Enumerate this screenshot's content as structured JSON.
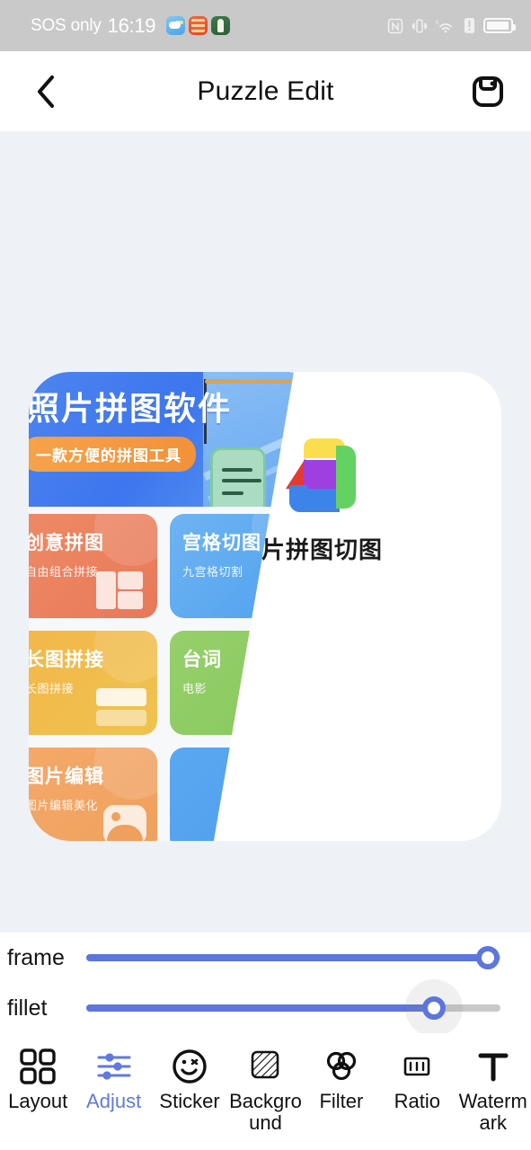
{
  "statusbar": {
    "carrier": "SOS only",
    "time": "16:19",
    "app_icons": [
      "weather-app-icon",
      "orange-app-icon",
      "green-app-icon"
    ],
    "right_icons": [
      "nfc-icon",
      "vibrate-icon",
      "wifi-6-icon",
      "sim-alert-icon",
      "battery-icon"
    ]
  },
  "titlebar": {
    "back_icon": "chevron-left-icon",
    "title": "Puzzle Edit",
    "save_icon": "save-icon"
  },
  "canvas": {
    "background_color": "#eef1f6",
    "left_photo": {
      "hero_title": "照片拼图软件",
      "hero_pill": "一款方便的拼图工具",
      "cards": [
        {
          "title": "创意拼图",
          "subtitle": "自由组合拼接",
          "color": "#ef8a65"
        },
        {
          "title": "宫格切图",
          "subtitle": "九宫格切割",
          "color": "#6fb4f2"
        },
        {
          "title": "长图拼接",
          "subtitle": "长图拼接",
          "color": "#f3b64a"
        },
        {
          "title": "台词",
          "subtitle": "电影",
          "color": "#97cf6b"
        },
        {
          "title": "图片编辑",
          "subtitle": "图片编辑美化",
          "color": "#f4a96a"
        },
        {
          "title": "",
          "subtitle": "",
          "color": "#5aa8f0"
        }
      ]
    },
    "right_photo": {
      "logo_icon": "puzzle-app-logo-icon",
      "label": "照片拼图切图",
      "background_color": "#ffffff"
    }
  },
  "sliders": [
    {
      "label": "frame",
      "value": 97
    },
    {
      "label": "fillet",
      "value": 84
    }
  ],
  "slider_colors": {
    "fill": "#5d76dc",
    "track": "#c9c9c9"
  },
  "tabs": [
    {
      "label": "Layout",
      "icon": "grid-layout-icon",
      "active": false
    },
    {
      "label": "Adjust",
      "icon": "sliders-icon",
      "active": true
    },
    {
      "label": "Sticker",
      "icon": "smiley-icon",
      "active": false
    },
    {
      "label": "Background",
      "icon": "hatch-square-icon",
      "active": false
    },
    {
      "label": "Filter",
      "icon": "three-circles-icon",
      "active": false
    },
    {
      "label": "Ratio",
      "icon": "aspect-ratio-icon",
      "active": false
    },
    {
      "label": "Watermark",
      "icon": "text-t-icon",
      "active": false
    }
  ],
  "accent_color": "#6079e0"
}
